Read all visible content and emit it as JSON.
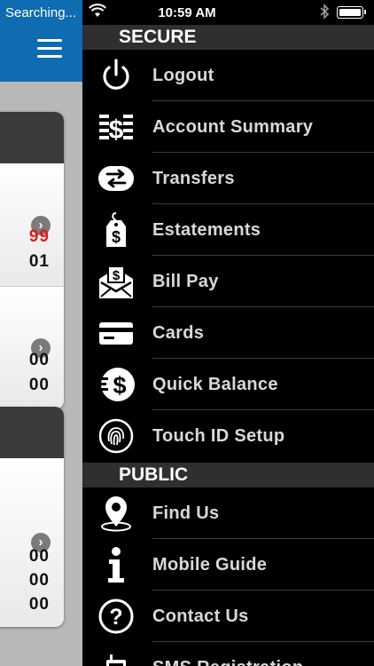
{
  "status_bar": {
    "carrier": "Searching...",
    "time": "10:59 AM"
  },
  "background_app": {
    "card1_amounts": [
      "99",
      "01"
    ],
    "card2_amounts": [
      "00",
      "00"
    ],
    "card3_amounts": [
      "00",
      "00",
      "00"
    ],
    "chevron_glyph": "›"
  },
  "drawer": {
    "secure_header": "SECURE",
    "public_header": "PUBLIC",
    "secure_items": [
      {
        "label": "Logout",
        "icon": "power-icon"
      },
      {
        "label": "Account Summary",
        "icon": "dollar-lines-icon"
      },
      {
        "label": "Transfers",
        "icon": "transfer-arrows-icon"
      },
      {
        "label": "Estatements",
        "icon": "price-tag-dollar-icon"
      },
      {
        "label": "Bill Pay",
        "icon": "envelope-dollar-icon"
      },
      {
        "label": "Cards",
        "icon": "credit-card-icon"
      },
      {
        "label": "Quick Balance",
        "icon": "speed-dollar-icon"
      },
      {
        "label": "Touch ID Setup",
        "icon": "fingerprint-icon"
      }
    ],
    "public_items": [
      {
        "label": "Find Us",
        "icon": "map-pin-icon"
      },
      {
        "label": "Mobile Guide",
        "icon": "info-icon"
      },
      {
        "label": "Contact Us",
        "icon": "question-circle-icon"
      },
      {
        "label": "SMS Registration",
        "icon": "phone-icon"
      }
    ]
  },
  "colors": {
    "topbar_blue": "#0f6bb2",
    "drawer_bg": "#000000",
    "section_header_bg": "#2f2f2f",
    "label_text": "#d9d9d9",
    "amount_red": "#e01a1a"
  }
}
